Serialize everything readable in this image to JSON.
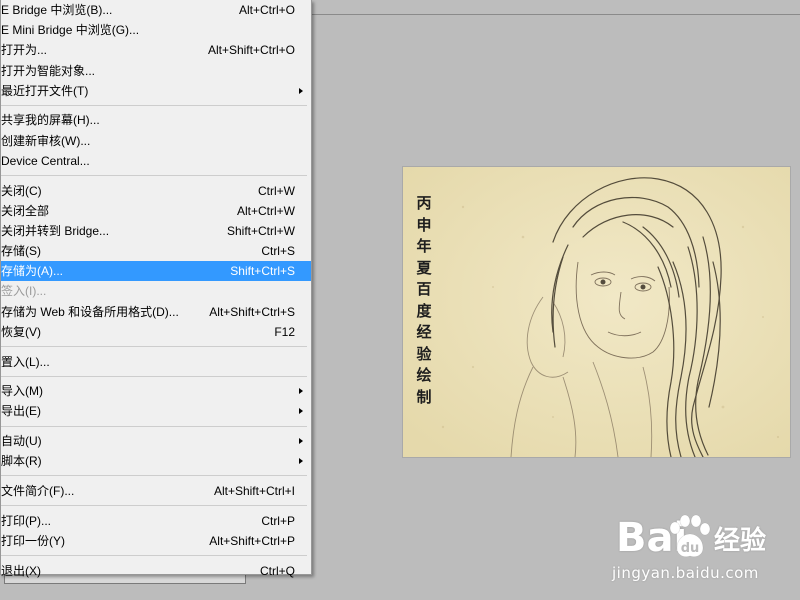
{
  "menu": {
    "items": [
      {
        "label": "E Bridge 中浏览(B)...",
        "shortcut": "Alt+Ctrl+O"
      },
      {
        "label": "E Mini Bridge 中浏览(G)...",
        "shortcut": ""
      },
      {
        "label": "打开为...",
        "shortcut": "Alt+Shift+Ctrl+O"
      },
      {
        "label": "打开为智能对象...",
        "shortcut": ""
      },
      {
        "label": "最近打开文件(T)",
        "shortcut": "",
        "submenu": true
      },
      {
        "separator": true
      },
      {
        "label": "共享我的屏幕(H)...",
        "shortcut": ""
      },
      {
        "label": "创建新审核(W)...",
        "shortcut": ""
      },
      {
        "label": "Device Central...",
        "shortcut": ""
      },
      {
        "separator": true
      },
      {
        "label": "关闭(C)",
        "shortcut": "Ctrl+W"
      },
      {
        "label": "关闭全部",
        "shortcut": "Alt+Ctrl+W"
      },
      {
        "label": "关闭并转到 Bridge...",
        "shortcut": "Shift+Ctrl+W"
      },
      {
        "label": "存储(S)",
        "shortcut": "Ctrl+S"
      },
      {
        "label": "存储为(A)...",
        "shortcut": "Shift+Ctrl+S",
        "highlight": true
      },
      {
        "label": "签入(I)...",
        "shortcut": "",
        "disabled": true
      },
      {
        "label": "存储为 Web 和设备所用格式(D)...",
        "shortcut": "Alt+Shift+Ctrl+S"
      },
      {
        "label": "恢复(V)",
        "shortcut": "F12"
      },
      {
        "separator": true
      },
      {
        "label": "置入(L)...",
        "shortcut": ""
      },
      {
        "separator": true
      },
      {
        "label": "导入(M)",
        "shortcut": "",
        "submenu": true
      },
      {
        "label": "导出(E)",
        "shortcut": "",
        "submenu": true
      },
      {
        "separator": true
      },
      {
        "label": "自动(U)",
        "shortcut": "",
        "submenu": true
      },
      {
        "label": "脚本(R)",
        "shortcut": "",
        "submenu": true
      },
      {
        "separator": true
      },
      {
        "label": "文件简介(F)...",
        "shortcut": "Alt+Shift+Ctrl+I"
      },
      {
        "separator": true
      },
      {
        "label": "打印(P)...",
        "shortcut": "Ctrl+P"
      },
      {
        "label": "打印一份(Y)",
        "shortcut": "Alt+Shift+Ctrl+P"
      },
      {
        "separator": true
      },
      {
        "label": "退出(X)",
        "shortcut": "Ctrl+Q"
      }
    ]
  },
  "canvas": {
    "caption_chars": [
      "丙",
      "申",
      "年",
      "夏",
      "百",
      "度",
      "经",
      "验",
      "绘",
      "制"
    ]
  },
  "watermark": {
    "logo": "Bai",
    "brand_cn": "经验",
    "url": "jingyan.baidu.com"
  },
  "colors": {
    "highlight": "#3399ff",
    "menu_bg": "#f0f0f0",
    "workspace": "#bcbcbc",
    "paper": "#ece2bd"
  }
}
